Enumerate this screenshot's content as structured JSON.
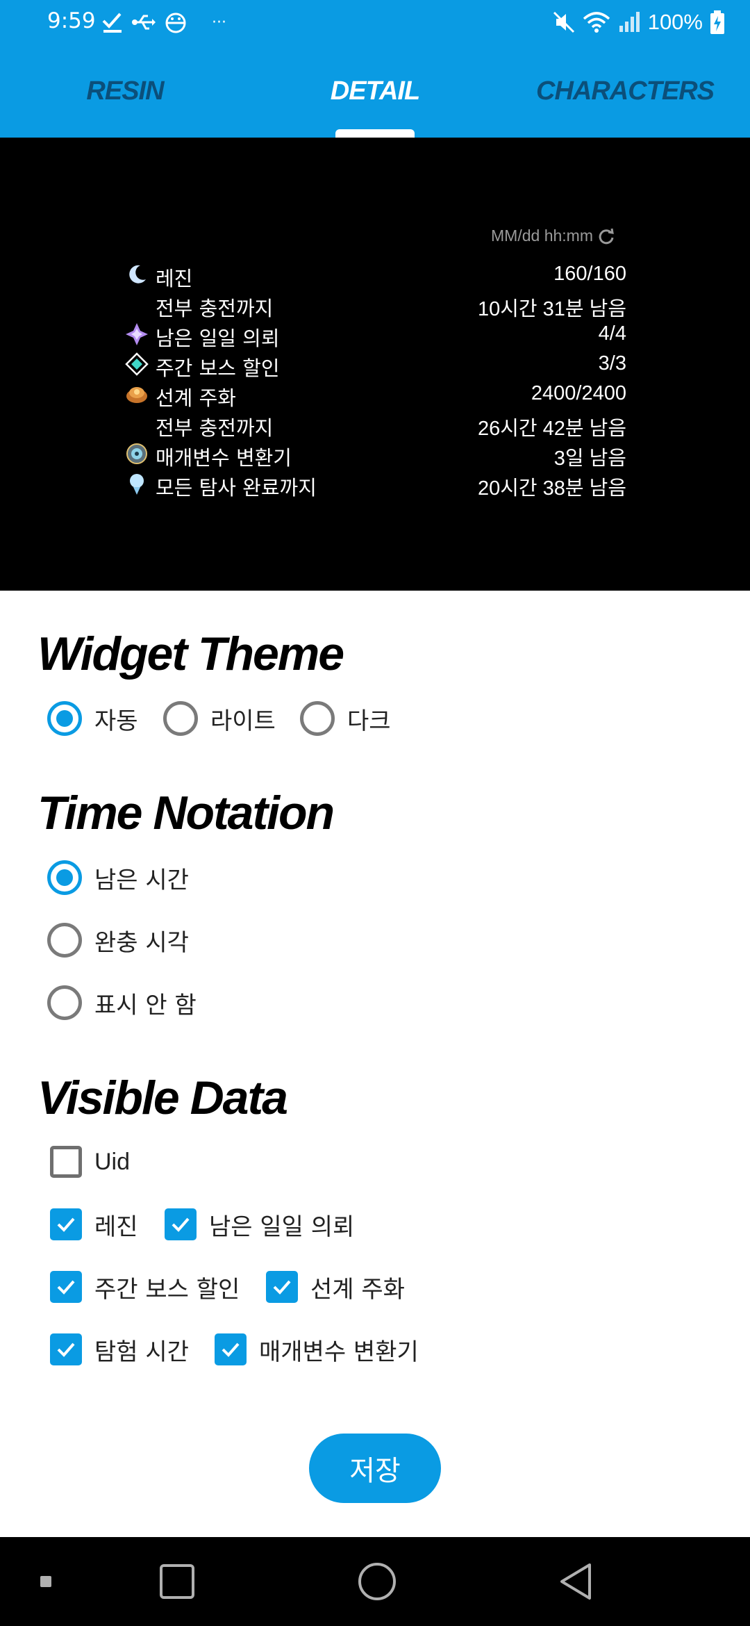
{
  "status_bar": {
    "time": "9:59",
    "battery": "100%",
    "icons": [
      "check-icon",
      "usb-icon",
      "android-debug-icon",
      "more-notifications-icon",
      "mute-icon",
      "wifi-icon",
      "signal-icon",
      "battery-charging-icon"
    ]
  },
  "tabs": [
    {
      "label": "RESIN",
      "active": false
    },
    {
      "label": "DETAIL",
      "active": true
    },
    {
      "label": "CHARACTERS",
      "active": false
    }
  ],
  "colors": {
    "accent": "#0a9be3",
    "inactive_tab": "#0b4f7a",
    "preview_bg": "#000000"
  },
  "preview": {
    "date_format": "MM/dd hh:mm",
    "rows": [
      {
        "icon": "resin-moon-icon",
        "label": "레진",
        "value": "160/160"
      },
      {
        "icon": "",
        "label": "전부 충전까지",
        "value": "10시간 31분 남음"
      },
      {
        "icon": "daily-commission-icon",
        "label": "남은 일일 의뢰",
        "value": "4/4"
      },
      {
        "icon": "weekly-boss-icon",
        "label": "주간 보스 할인",
        "value": "3/3"
      },
      {
        "icon": "realm-currency-icon",
        "label": "선계 주화",
        "value": "2400/2400"
      },
      {
        "icon": "",
        "label": "전부 충전까지",
        "value": "26시간 42분 남음"
      },
      {
        "icon": "transformer-icon",
        "label": "매개변수 변환기",
        "value": "3일 남음"
      },
      {
        "icon": "expedition-icon",
        "label": "모든 탐사 완료까지",
        "value": "20시간 38분 남음"
      }
    ]
  },
  "widget_theme": {
    "title": "Widget Theme",
    "options": [
      "자동",
      "라이트",
      "다크"
    ],
    "selected": "자동"
  },
  "time_notation": {
    "title": "Time Notation",
    "options": [
      "남은 시간",
      "완충 시각",
      "표시 안 함"
    ],
    "selected": "남은 시간"
  },
  "visible_data": {
    "title": "Visible Data",
    "items": [
      {
        "label": "Uid",
        "checked": false
      },
      {
        "label": "레진",
        "checked": true
      },
      {
        "label": "남은 일일 의뢰",
        "checked": true
      },
      {
        "label": "주간 보스 할인",
        "checked": true
      },
      {
        "label": "선계 주화",
        "checked": true
      },
      {
        "label": "탐험 시간",
        "checked": true
      },
      {
        "label": "매개변수 변환기",
        "checked": true
      }
    ]
  },
  "save_label": "저장",
  "nav": [
    "recents-dot",
    "overview-square-icon",
    "home-circle-icon",
    "back-triangle-icon"
  ]
}
